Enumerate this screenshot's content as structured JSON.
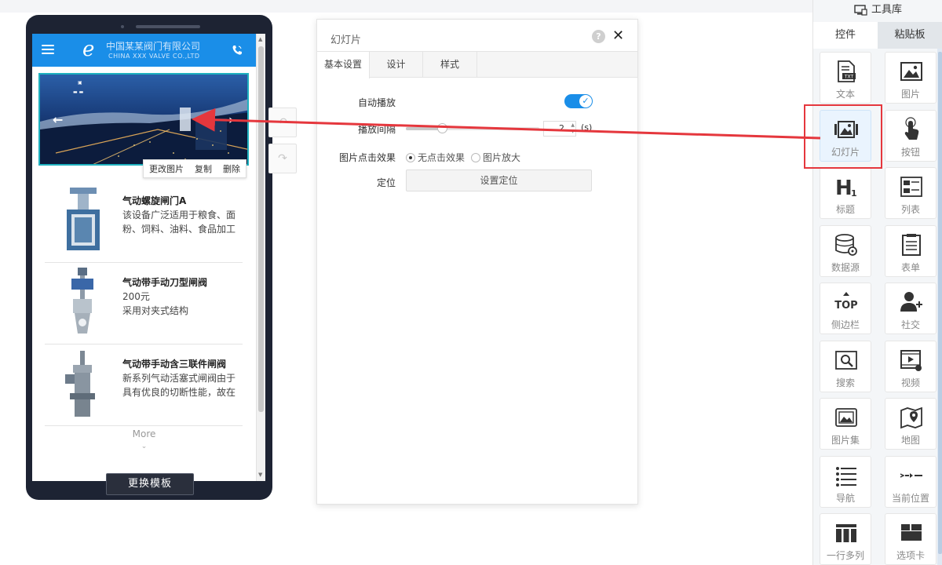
{
  "phone": {
    "company_cn": "中国某某阀门有限公司",
    "company_en": "CHINA XXX VALVE CO.,LTD",
    "banner_actions": [
      "更改图片",
      "复制",
      "删除"
    ],
    "products": [
      {
        "title": "气动螺旋闸门A",
        "desc": "该设备广泛适用于粮食、面粉、饲料、油料、食品加工"
      },
      {
        "title": "气动带手动刀型闸阀",
        "desc": "200元\n采用对夹式结构"
      },
      {
        "title": "气动带手动含三联件闸阀",
        "desc": "新系列气动活塞式闸阀由于具有优良的切断性能，故在"
      }
    ],
    "more": "More",
    "more_chevron": "⌄",
    "switch_template": "更换模板"
  },
  "dialog": {
    "title": "幻灯片",
    "help": "?",
    "close": "✕",
    "tabs": [
      "基本设置",
      "设计",
      "样式"
    ],
    "autoplay_label": "自动播放",
    "autoplay_on": true,
    "interval_label": "播放间隔",
    "interval_value": "2",
    "interval_unit": "(s)",
    "interval_level": 0.27,
    "click_effect_label": "图片点击效果",
    "click_options": [
      "无点击效果",
      "图片放大"
    ],
    "click_selected": 0,
    "position_label": "定位",
    "position_button": "设置定位"
  },
  "toolbox": {
    "title": "工具库",
    "tabs": [
      "控件",
      "粘贴板"
    ],
    "tools": [
      {
        "label": "文本",
        "icon": "text-icon"
      },
      {
        "label": "图片",
        "icon": "image-icon"
      },
      {
        "label": "幻灯片",
        "icon": "slideshow-icon"
      },
      {
        "label": "按钮",
        "icon": "button-icon"
      },
      {
        "label": "标题",
        "icon": "heading-icon"
      },
      {
        "label": "列表",
        "icon": "list-icon"
      },
      {
        "label": "数据源",
        "icon": "datasource-icon"
      },
      {
        "label": "表单",
        "icon": "form-icon"
      },
      {
        "label": "侧边栏",
        "icon": "sidebar-icon"
      },
      {
        "label": "社交",
        "icon": "social-icon"
      },
      {
        "label": "搜索",
        "icon": "search-icon"
      },
      {
        "label": "视频",
        "icon": "video-icon"
      },
      {
        "label": "图片集",
        "icon": "gallery-icon"
      },
      {
        "label": "地图",
        "icon": "map-icon"
      },
      {
        "label": "导航",
        "icon": "nav-icon"
      },
      {
        "label": "当前位置",
        "icon": "breadcrumb-icon"
      },
      {
        "label": "一行多列",
        "icon": "columns-icon"
      },
      {
        "label": "选项卡",
        "icon": "tabs-icon"
      }
    ]
  },
  "colors": {
    "brand": "#1a8ee8",
    "highlight": "#e5373d",
    "phone_frame": "#1d2333"
  }
}
